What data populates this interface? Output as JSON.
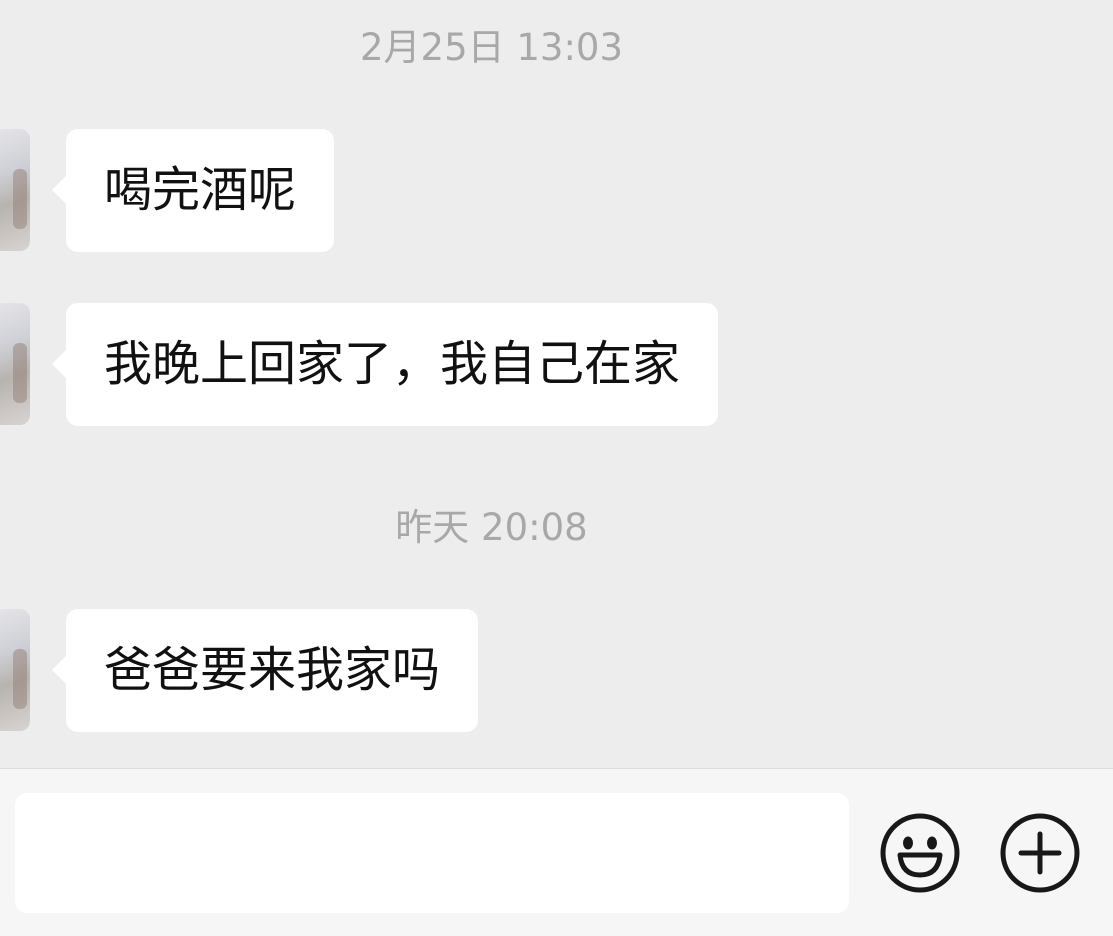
{
  "chat": {
    "messages_area": [
      {
        "type": "timestamp",
        "text": "2月25日 13:03"
      },
      {
        "type": "incoming",
        "text": "喝完酒呢"
      },
      {
        "type": "incoming",
        "text": "我晚上回家了，我自己在家"
      },
      {
        "type": "timestamp",
        "text": "昨天 20:08"
      },
      {
        "type": "incoming",
        "text": "爸爸要来我家吗"
      }
    ]
  },
  "input_bar": {
    "text_value": "",
    "icons": [
      "emoji-icon",
      "plus-icon"
    ]
  },
  "colors": {
    "background": "#ededed",
    "bubble": "#ffffff",
    "timestamp_text": "#a8a8a8",
    "message_text": "#111111",
    "icon_stroke": "#181818"
  }
}
